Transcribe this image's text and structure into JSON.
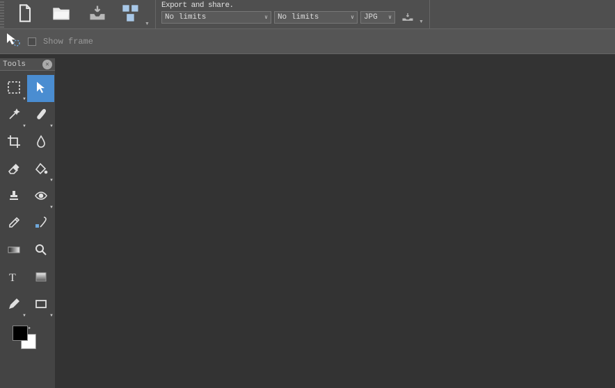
{
  "export": {
    "title": "Export and share.",
    "select1": "No limits",
    "select2": "No limits",
    "format": "JPG"
  },
  "secondbar": {
    "show_frame_label": "Show frame"
  },
  "tools": {
    "panel_title": "Tools"
  }
}
